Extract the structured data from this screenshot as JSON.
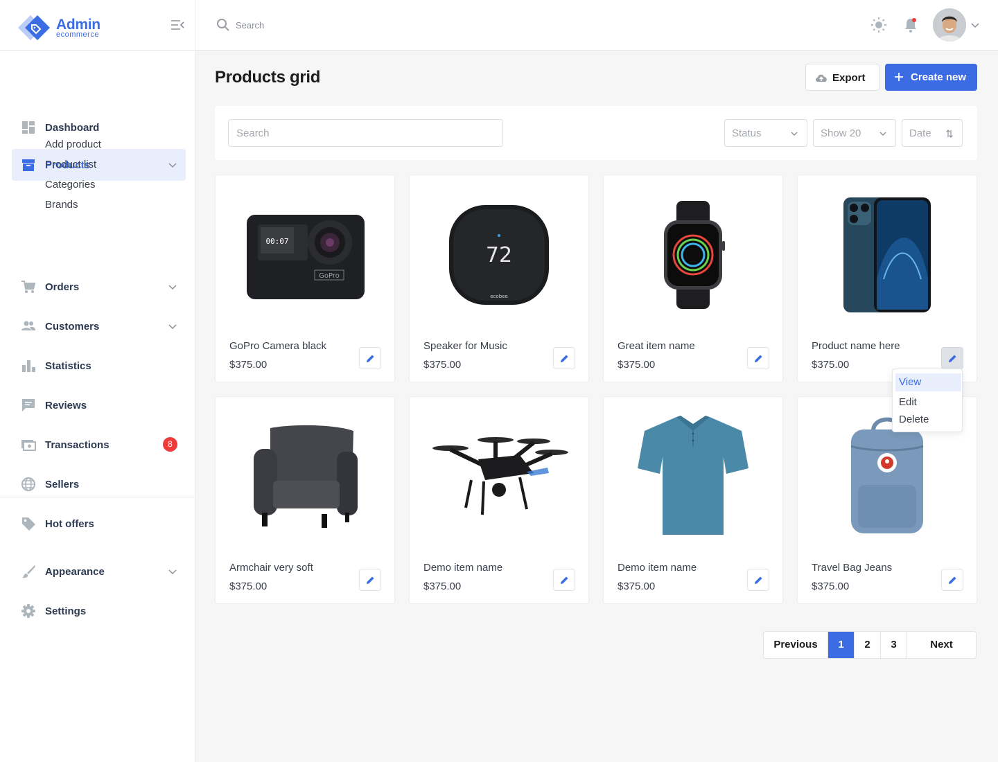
{
  "brand": {
    "name": "Admin",
    "subtitle": "ecommerce"
  },
  "header": {
    "search_placeholder": "Search"
  },
  "sidebar": {
    "items": [
      {
        "label": "Dashboard",
        "icon": "dashboard-icon"
      },
      {
        "label": "Products",
        "icon": "archive-box-icon",
        "active": true
      },
      {
        "label": "Orders",
        "icon": "cart-icon"
      },
      {
        "label": "Customers",
        "icon": "people-icon"
      },
      {
        "label": "Statistics",
        "icon": "bar-chart-icon"
      },
      {
        "label": "Reviews",
        "icon": "comment-icon"
      },
      {
        "label": "Transactions",
        "icon": "money-icon",
        "badge": "8"
      },
      {
        "label": "Sellers",
        "icon": "globe-icon"
      },
      {
        "label": "Hot offers",
        "icon": "tag-icon"
      },
      {
        "label": "Appearance",
        "icon": "brush-icon"
      },
      {
        "label": "Settings",
        "icon": "gear-icon"
      }
    ],
    "submenu": [
      "Add product",
      "Product list",
      "Categories",
      "Brands"
    ]
  },
  "page": {
    "title": "Products grid",
    "export_label": "Export",
    "create_label": "Create new"
  },
  "filters": {
    "search_placeholder": "Search",
    "status_label": "Status",
    "show_label": "Show 20",
    "date_label": "Date"
  },
  "products": [
    {
      "name": "GoPro Camera black",
      "price": "$375.00",
      "image": "camera-image"
    },
    {
      "name": "Speaker for Music",
      "price": "$375.00",
      "image": "thermostat-image"
    },
    {
      "name": "Great item name",
      "price": "$375.00",
      "image": "smartwatch-image"
    },
    {
      "name": "Product name here",
      "price": "$375.00",
      "image": "smartphone-image"
    },
    {
      "name": "Armchair very soft",
      "price": "$375.00",
      "image": "armchair-image"
    },
    {
      "name": "Demo item name",
      "price": "$375.00",
      "image": "drone-image"
    },
    {
      "name": "Demo item name",
      "price": "$375.00",
      "image": "polo-shirt-image"
    },
    {
      "name": "Travel Bag Jeans",
      "price": "$375.00",
      "image": "backpack-image"
    }
  ],
  "thermostat_reading": "72",
  "thermostat_brand": "ecobee",
  "dropdown": {
    "items": [
      "View",
      "Edit",
      "Delete"
    ]
  },
  "pagination": {
    "previous": "Previous",
    "pages": [
      "1",
      "2",
      "3"
    ],
    "current": "1",
    "next": "Next"
  },
  "colors": {
    "accent": "#3c6ce3",
    "badge": "#ef3b3b",
    "active_bg": "#e8eefc"
  }
}
